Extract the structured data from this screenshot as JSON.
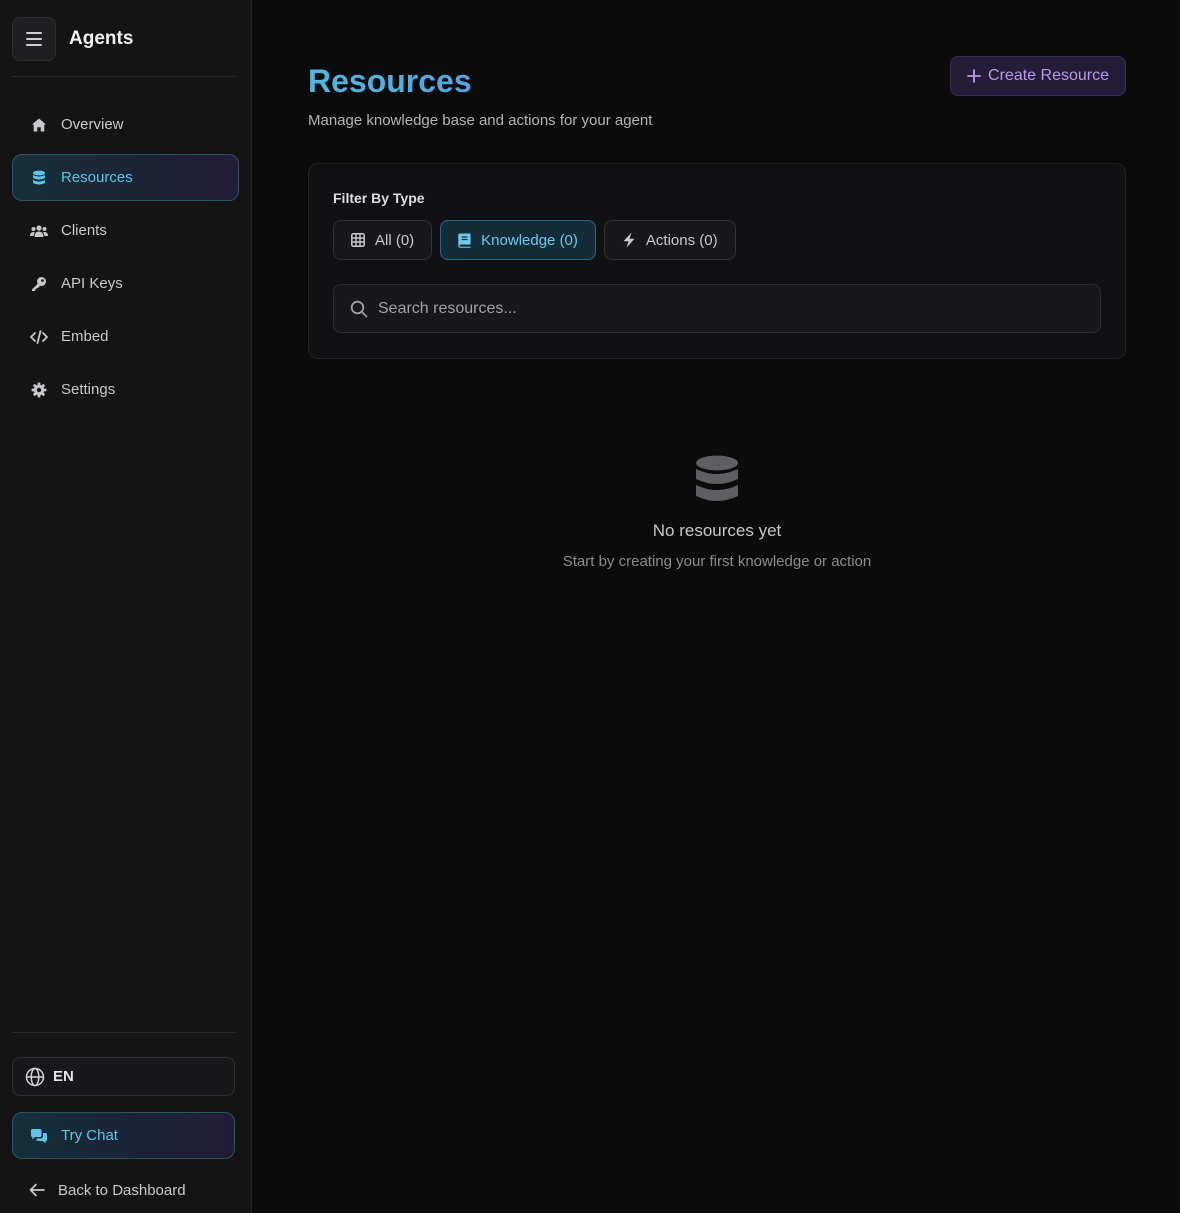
{
  "sidebar": {
    "title": "Agents",
    "items": [
      {
        "label": "Overview",
        "icon": "home-icon"
      },
      {
        "label": "Resources",
        "icon": "database-icon",
        "active": true
      },
      {
        "label": "Clients",
        "icon": "users-icon"
      },
      {
        "label": "API Keys",
        "icon": "key-icon"
      },
      {
        "label": "Embed",
        "icon": "code-icon"
      },
      {
        "label": "Settings",
        "icon": "gear-icon"
      }
    ],
    "language": "EN",
    "try_chat": "Try Chat",
    "back": "Back to Dashboard"
  },
  "main": {
    "title": "Resources",
    "subtitle": "Manage knowledge base and actions for your agent",
    "create_button": "Create Resource",
    "filter": {
      "label": "Filter By Type",
      "tabs": [
        {
          "label": "All (0)",
          "icon": "grid-icon"
        },
        {
          "label": "Knowledge (0)",
          "icon": "book-icon",
          "active": true
        },
        {
          "label": "Actions (0)",
          "icon": "bolt-icon"
        }
      ]
    },
    "search": {
      "placeholder": "Search resources...",
      "value": ""
    },
    "empty": {
      "title": "No resources yet",
      "subtitle": "Start by creating your first knowledge or action"
    }
  },
  "colors": {
    "accent": "#5fc4e8",
    "create_accent": "#b99ae8",
    "background": "#0b0b0c",
    "sidebar": "#141415"
  }
}
